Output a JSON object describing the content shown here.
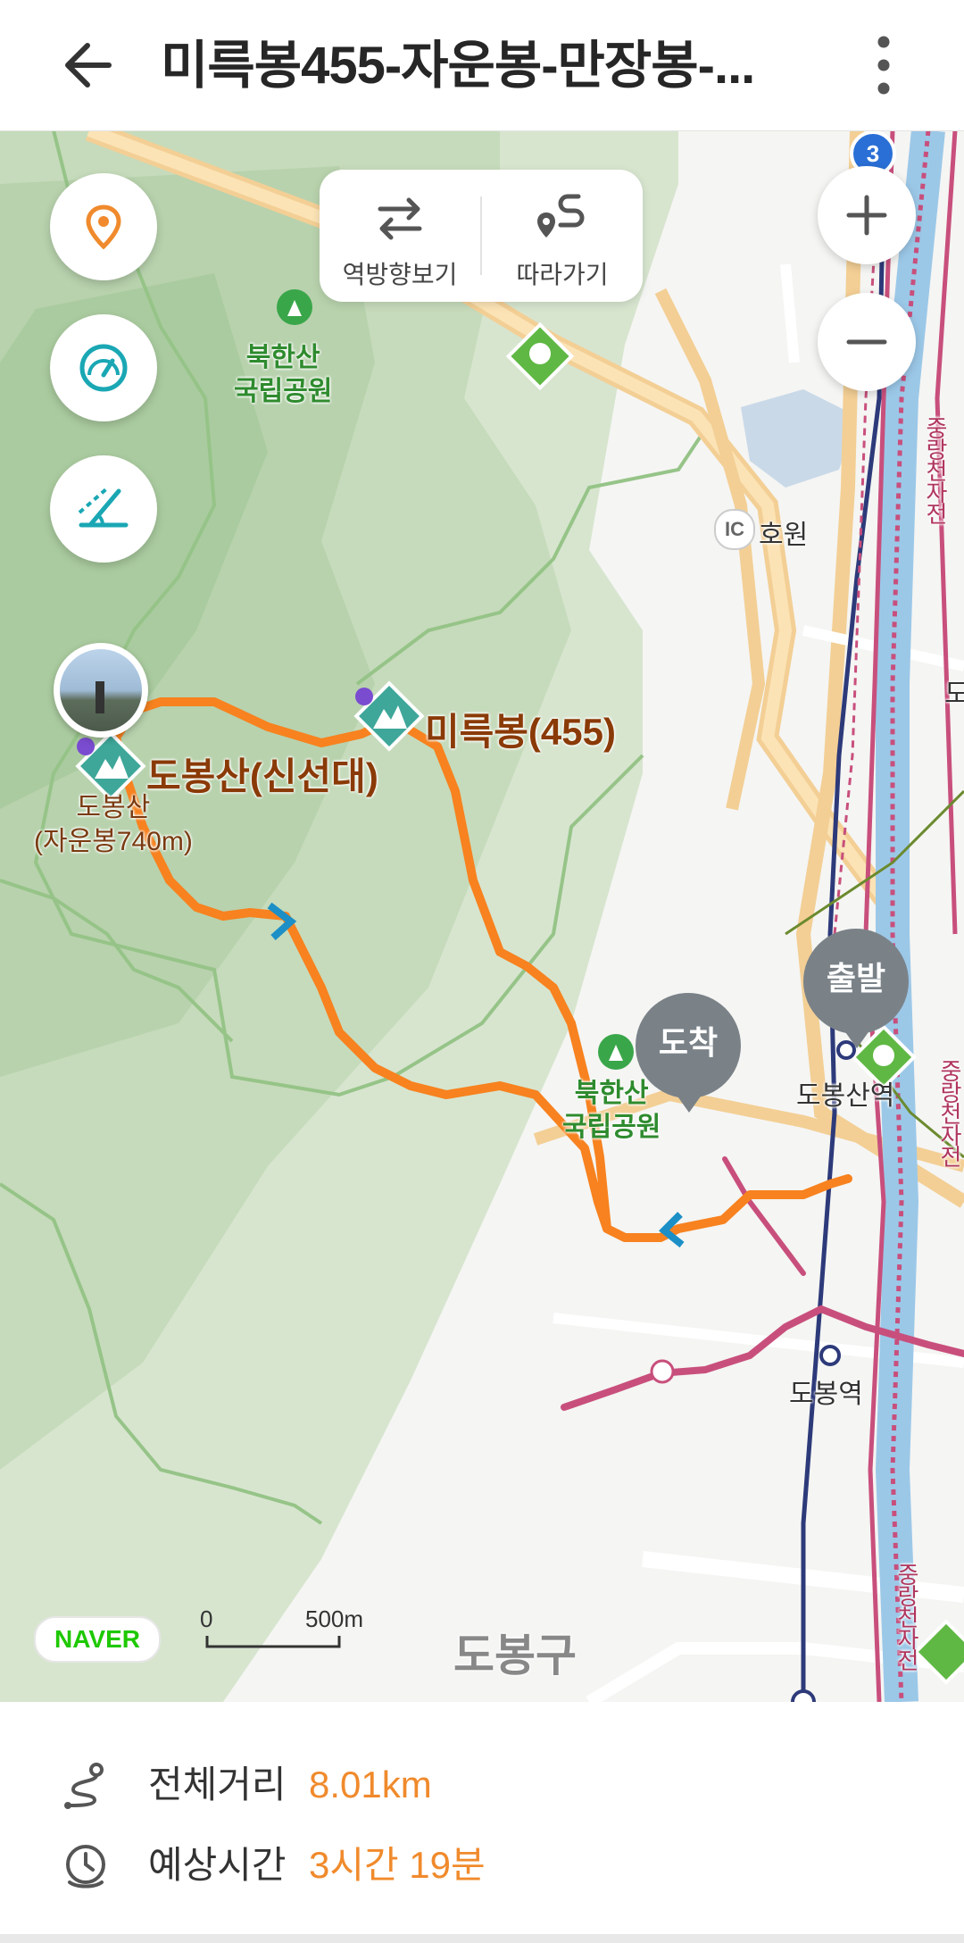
{
  "header": {
    "title": "미륵봉455-자운봉-만장봉-...",
    "back_icon": "arrow-left-icon",
    "more_icon": "more-vertical-icon"
  },
  "map_controls": {
    "location_icon": "location-pin-icon",
    "speedometer_icon": "speedometer-icon",
    "slope_icon": "slope-angle-icon",
    "reverse_label": "역방향보기",
    "follow_label": "따라가기",
    "zoom_in_icon": "plus-icon",
    "zoom_out_icon": "minus-icon"
  },
  "map": {
    "park_label_1": "북한산\n국립공원",
    "park_label_2": "북한산\n국립공원",
    "peak_1": "미륵봉(455)",
    "peak_2": "도봉산(신선대)",
    "peak_3": "도봉산\n(자운봉740m)",
    "interchange_badge": "IC",
    "interchange_name": "호원",
    "station_1": "도봉산역",
    "station_2": "도봉역",
    "district": "도봉구",
    "road_label_1": "중랑천자전",
    "road_label_2": "중랑천자전",
    "road_label_3": "중랑천자전",
    "edge_label": "도",
    "route_badge": "3",
    "start_label": "출발",
    "end_label": "도착",
    "logo": "NAVER",
    "scale_start": "0",
    "scale_end": "500m",
    "colors": {
      "route": "#f7821f",
      "bike_road": "#c84f7c",
      "subway": "#2d3a7a",
      "green_area": "#c9dcbc",
      "pin": "#7a8288",
      "value_accent": "#f08a2c"
    }
  },
  "summary": {
    "distance_label": "전체거리",
    "distance_value": "8.01km",
    "time_label": "예상시간",
    "time_value": "3시간 19분",
    "distance_icon": "route-icon",
    "time_icon": "clock-icon"
  }
}
